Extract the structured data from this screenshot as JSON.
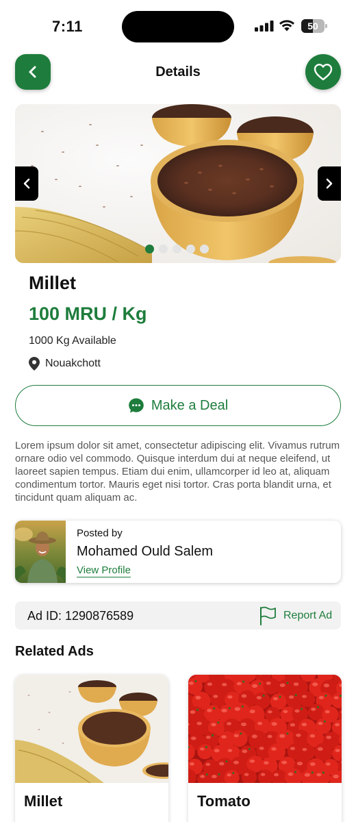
{
  "status_bar": {
    "time": "7:11",
    "battery": "50",
    "battery_level": 0.5
  },
  "header": {
    "title": "Details",
    "back_icon": "chevron-left-icon",
    "favorite_icon": "heart-outline-icon"
  },
  "carousel": {
    "image": "rice-bowls-photo",
    "slide_count": 5,
    "active_slide": 1
  },
  "product": {
    "name": "Millet",
    "price": "100 MRU / Kg",
    "availability": "1000 Kg Available",
    "location": "Nouakchott"
  },
  "deal_button": {
    "label": "Make a Deal",
    "icon": "chat-bubble-icon"
  },
  "description": "Lorem ipsum dolor sit amet, consectetur adipiscing elit. Vivamus rutrum ornare odio vel commodo. Quisque interdum dui at neque eleifend, ut laoreet sapien tempus. Etiam dui enim, ullamcorper id leo at, aliquam condimentum tortor. Mauris eget nisi tortor. Cras porta blandit urna, et tincidunt quam aliquam ac.",
  "poster": {
    "label": "Posted by",
    "name": "Mohamed Ould Salem",
    "view_profile": "View Profile"
  },
  "ad": {
    "id_text": "Ad ID: 1290876589",
    "report_label": "Report Ad",
    "report_icon": "flag-icon"
  },
  "related": {
    "heading": "Related Ads",
    "items": [
      {
        "name": "Millet"
      },
      {
        "name": "Tomato"
      }
    ]
  },
  "colors": {
    "accent": "#1e7d3c",
    "text": "#111111",
    "muted": "#555555"
  }
}
